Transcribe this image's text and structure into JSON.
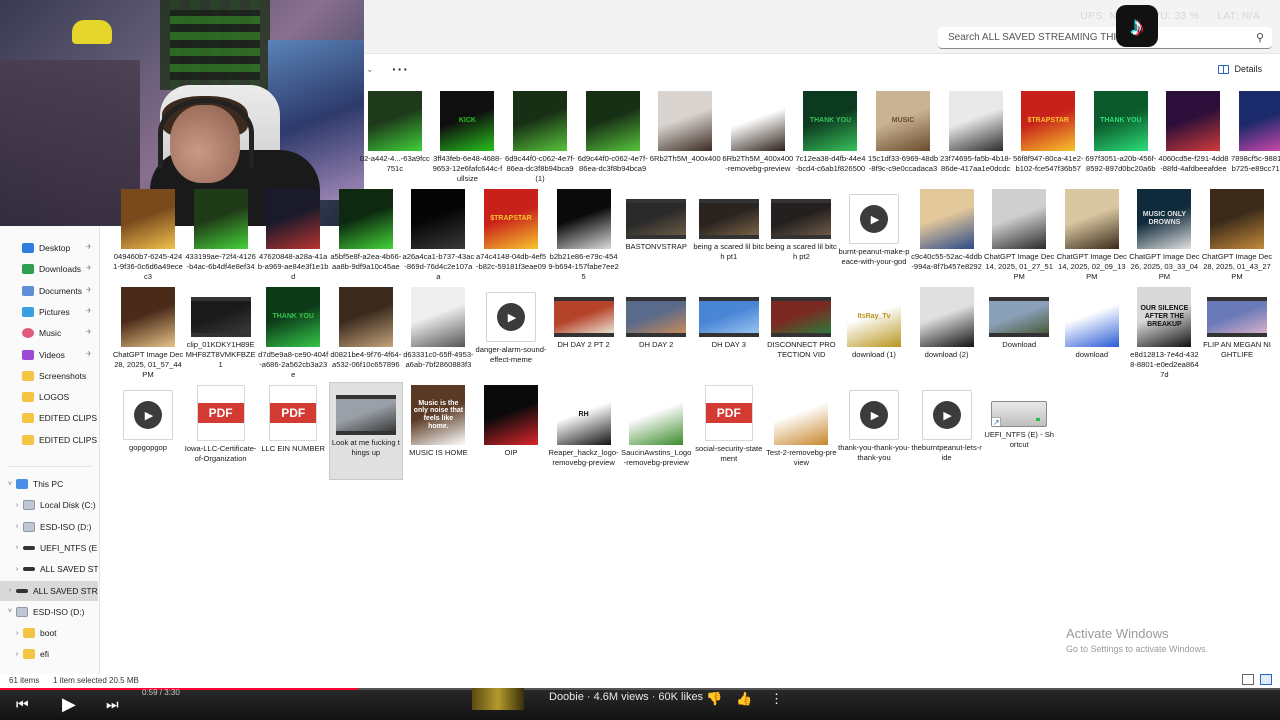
{
  "window": {
    "search_placeholder": "Search ALL SAVED STREAMING THINGS (E:)",
    "overlay_stats": [
      "UPS: N/A",
      "CPU: 33 %",
      "LAT: N/A"
    ]
  },
  "commandbar": {
    "more": "···",
    "details_label": "Details"
  },
  "sidebar": {
    "quick": [
      {
        "label": "Desktop",
        "icon": "desktop-icon"
      },
      {
        "label": "Downloads",
        "icon": "downloads-icon"
      },
      {
        "label": "Documents",
        "icon": "documents-icon"
      },
      {
        "label": "Pictures",
        "icon": "pictures-icon"
      },
      {
        "label": "Music",
        "icon": "music-icon"
      },
      {
        "label": "Videos",
        "icon": "videos-icon"
      },
      {
        "label": "Screenshots",
        "icon": "folder-icon"
      },
      {
        "label": "LOGOS",
        "icon": "folder-icon"
      },
      {
        "label": "EDITED CLIPS FO",
        "icon": "folder-icon"
      },
      {
        "label": "EDITED CLIPS FO",
        "icon": "folder-icon"
      }
    ],
    "tree": [
      {
        "label": "This PC",
        "icon": "pc-icon",
        "chevron": "˅"
      },
      {
        "label": "Local Disk (C:)",
        "icon": "disk-icon",
        "chevron": "›"
      },
      {
        "label": "ESD-ISO (D:)",
        "icon": "disk-icon",
        "chevron": "›"
      },
      {
        "label": "UEFI_NTFS (E:)",
        "icon": "drive-icon",
        "chevron": "›"
      },
      {
        "label": "ALL SAVED STRE",
        "icon": "drive-icon",
        "chevron": "›"
      },
      {
        "label": "ALL SAVED STRE",
        "icon": "drive-icon",
        "chevron": "›",
        "selected": true
      },
      {
        "label": "ESD-ISO (D:)",
        "icon": "disk-icon",
        "chevron": "˅"
      },
      {
        "label": "boot",
        "icon": "folder-icon",
        "chevron": "›"
      },
      {
        "label": "efi",
        "icon": "folder-icon",
        "chevron": "›"
      }
    ]
  },
  "files": [
    [
      {
        "name": "02-a442-4...-63a9fcc 751c",
        "kind": "image",
        "color": "#1e3a1a",
        "accent": "#3fd13a"
      },
      {
        "name": "3ff43feb-6e48-4688-9653-12e6fafc644c-fullsize",
        "kind": "image",
        "color": "#0f0f0f",
        "accent": "#26c21d",
        "text": "KICK"
      },
      {
        "name": "6d9c44f0-c062-4e7f-86ea-dc3f8b94bca9 (1)",
        "kind": "image",
        "color": "#173015",
        "accent": "#58c43c"
      },
      {
        "name": "6d9c44f0-c062-4e7f-86ea-dc3f8b94bca9",
        "kind": "image",
        "color": "#173015",
        "accent": "#58c43c"
      },
      {
        "name": "6Rb2Th5M_400x400",
        "kind": "image",
        "color": "#d9d4cf",
        "accent": "#3b2a22"
      },
      {
        "name": "6Rb2Th5M_400x400-removebg-preview",
        "kind": "image",
        "color": "#ffffff",
        "accent": "#2d2018"
      },
      {
        "name": "7c12ea38-d4fb-44e4-bcd4-c6ab1f826500",
        "kind": "image",
        "color": "#0c3a20",
        "accent": "#39c15a",
        "text": "THANK YOU"
      },
      {
        "name": "15c1df33-6969-48db-8f9c-c9e0ccadaca3",
        "kind": "image",
        "color": "#c9b392",
        "accent": "#6a4a2e",
        "text": "MUSIC"
      },
      {
        "name": "23f74695-fa5b-4b18-86de-417aa1e0dcdc",
        "kind": "image",
        "color": "#e9e9e9",
        "accent": "#2b2b2b"
      },
      {
        "name": "56f8f947-80ca-41e2-b102-fce547f36b57",
        "kind": "image",
        "color": "#c8201a",
        "accent": "#f7c52d",
        "text": "$TRAPSTAR"
      },
      {
        "name": "697f3051-a20b-456f-8592-897d0bc20a6b",
        "kind": "image",
        "color": "#0b5a2b",
        "accent": "#2de07a",
        "text": "THANK YOU"
      },
      {
        "name": "4060cd5e-f291-4dd8-88fd-4afdbeeafdee",
        "kind": "image",
        "color": "#2b0f3a",
        "accent": "#d13b3b"
      },
      {
        "name": "7898cf5c-9881-4f67-b725-e89cc7198bc7",
        "kind": "image",
        "color": "#1a2a6b",
        "accent": "#e04ab1"
      }
    ],
    [
      {
        "name": "049460b7-6245-4241-9f36-0c6d6a49ecec3",
        "kind": "image",
        "color": "#7a4a1c",
        "accent": "#f2c14e"
      },
      {
        "name": "433199ae-72f4-4126-b4ac-6b4df4e8ef34",
        "kind": "image",
        "color": "#1f3a17",
        "accent": "#46d33a"
      },
      {
        "name": "47620848-a28a-41ab-a969-ae84e3f1e1bd",
        "kind": "image",
        "color": "#1a1a2a",
        "accent": "#b8342f"
      },
      {
        "name": "a5bf5e8f-a2ea-4b66-aa8b-9df9a10c45ae",
        "kind": "image",
        "color": "#0d2a10",
        "accent": "#44d438"
      },
      {
        "name": "a26a4ca1-b737-43ac-869d-76d4c2e107aa",
        "kind": "image",
        "color": "#050505",
        "accent": "#3a3a3a"
      },
      {
        "name": "a74c4148-04db-4ef5-b82c-59181f3eae09",
        "kind": "image",
        "color": "#c8201a",
        "accent": "#f7c52d",
        "text": "$TRAPSTAR"
      },
      {
        "name": "b2b21e86-e79c-4549-b694-157fabe7ee25",
        "kind": "image",
        "color": "#0a0a0a",
        "accent": "#dcdcdc"
      },
      {
        "name": "BASTONVSTRAP",
        "kind": "video",
        "color": "#2a2a2a",
        "accent": "#6b5a44"
      },
      {
        "name": "being a scared lil bitch pt1",
        "kind": "video",
        "color": "#2a2420",
        "accent": "#7a6248"
      },
      {
        "name": "being a scared lil bitch pt2",
        "kind": "video",
        "color": "#242020",
        "accent": "#6e5a48"
      },
      {
        "name": "burnt-peanut-make-peace-with-your-god",
        "kind": "play"
      },
      {
        "name": "c9c40c55-52ac-4ddb-994a-8f7b457e8292",
        "kind": "image",
        "color": "#e2c89a",
        "accent": "#2c4a8a"
      },
      {
        "name": "ChatGPT Image Dec 14, 2025, 01_27_51 PM",
        "kind": "image",
        "color": "#cfcfcf",
        "accent": "#2a2a2a"
      },
      {
        "name": "ChatGPT Image Dec 14, 2025, 02_09_13 PM",
        "kind": "image",
        "color": "#d9c7a2",
        "accent": "#3a2a1a"
      },
      {
        "name": "ChatGPT Image Dec 26, 2025, 03_33_04 PM",
        "kind": "image",
        "color": "#0f2a3a",
        "accent": "#e0e0e0",
        "text": "MUSIC ONLY DROWNS"
      },
      {
        "name": "ChatGPT Image Dec 28, 2025, 01_43_27 PM",
        "kind": "image",
        "color": "#3a2a1a",
        "accent": "#c48a3a"
      }
    ],
    [
      {
        "name": "ChatGPT Image Dec 28, 2025, 01_57_44 PM",
        "kind": "image",
        "color": "#4a2a18",
        "accent": "#e7c48a"
      },
      {
        "name": "clip_01KDKY1H89EMHF8ZT8VMKFBZE1",
        "kind": "video",
        "color": "#1a1a1a",
        "accent": "#3a3a3a"
      },
      {
        "name": "d7d5e9a8-ce90-404f-a686-2a562cb3a23e",
        "kind": "image",
        "color": "#0c3a18",
        "accent": "#35c64a",
        "text": "THANK YOU"
      },
      {
        "name": "d0821be4-9f76-4f64-a532-06f10c657896",
        "kind": "image",
        "color": "#3a2a1e",
        "accent": "#c5a37a"
      },
      {
        "name": "d63331c0-65ff-4953-a6ab-7bf2860883f3",
        "kind": "image",
        "color": "#efefef",
        "accent": "#555555"
      },
      {
        "name": "danger-alarm-sound-effect-meme",
        "kind": "play"
      },
      {
        "name": "DH DAY 2 PT 2",
        "kind": "video",
        "color": "#b5432a",
        "accent": "#e9e1d0"
      },
      {
        "name": "DH DAY 2",
        "kind": "video",
        "color": "#5a6a8a",
        "accent": "#c98a5a"
      },
      {
        "name": "DH DAY 3",
        "kind": "video",
        "color": "#4a86d6",
        "accent": "#9ac4f0"
      },
      {
        "name": "DISCONNECT PROTECTION VID",
        "kind": "video",
        "color": "#7a2a22",
        "accent": "#2e7a3a"
      },
      {
        "name": "download (1)",
        "kind": "image",
        "color": "#ffffff",
        "accent": "#b8951e",
        "text": "ItsRay_Tv"
      },
      {
        "name": "download (2)",
        "kind": "image",
        "color": "#e0e0e0",
        "accent": "#111111"
      },
      {
        "name": "Download",
        "kind": "video",
        "color": "#8aa0b8",
        "accent": "#4a5a3a"
      },
      {
        "name": "download",
        "kind": "image",
        "color": "#ffffff",
        "accent": "#2a5bd6"
      },
      {
        "name": "e8d12813-7e4d-4328-8801-e0ed2ea8647d",
        "kind": "image",
        "color": "#d8d8d8",
        "accent": "#111111",
        "text": "OUR SILENCE AFTER THE BREAKUP"
      },
      {
        "name": "FLIP AN MEGAN NIGHTLIFE",
        "kind": "video",
        "color": "#6a7ab8",
        "accent": "#d8b0c8"
      }
    ],
    [
      {
        "name": "gopgopgop",
        "kind": "play"
      },
      {
        "name": "Iowa-LLC-Certificate-of-Organization",
        "kind": "pdf"
      },
      {
        "name": "LLC EIN NUMBER",
        "kind": "pdf"
      },
      {
        "name": "Look at me fucking things up",
        "kind": "video",
        "color": "#9aa0a8",
        "accent": "#3a3a3a",
        "selected": true
      },
      {
        "name": "MUSIC IS HOME",
        "kind": "image",
        "color": "#5a3a24",
        "accent": "#ffffff",
        "text": "Music is the only noise that feels like home."
      },
      {
        "name": "OIP",
        "kind": "image",
        "color": "#0a0a0a",
        "accent": "#d8262c"
      },
      {
        "name": "Reaper_hackz_logo-removebg-preview",
        "kind": "image",
        "color": "#ffffff",
        "accent": "#111111",
        "text": "RH"
      },
      {
        "name": "SaucinAwstins_Logo-removebg-preview",
        "kind": "image",
        "color": "#ffffff",
        "accent": "#3a8a2a"
      },
      {
        "name": "social-security-statement",
        "kind": "pdf"
      },
      {
        "name": "Test-2-removebg-preview",
        "kind": "image",
        "color": "#ffffff",
        "accent": "#c8862a"
      },
      {
        "name": "thank-you-thank-you-thank-you",
        "kind": "play"
      },
      {
        "name": "theburntpeanut-lets-ride",
        "kind": "play"
      },
      {
        "name": "UEFI_NTFS (E) - Shortcut",
        "kind": "drive"
      }
    ]
  ],
  "file_glyphs": {
    "pdf": "PDF",
    "play": "▶",
    "shortcut": "↗"
  },
  "status": {
    "items": "61 items",
    "selected": "1 item selected  20.5 MB"
  },
  "watermark": {
    "title": "Activate Windows",
    "subtitle": "Go to Settings to activate Windows."
  },
  "player": {
    "time": "0:59 / 3:30",
    "progress": 0.28,
    "track": "Doobie · 4.6M views · 60K likes",
    "prev": "⏮",
    "play": "▶",
    "next": "⏭",
    "dislike": "👎",
    "like": "👍",
    "more": "⋮"
  }
}
